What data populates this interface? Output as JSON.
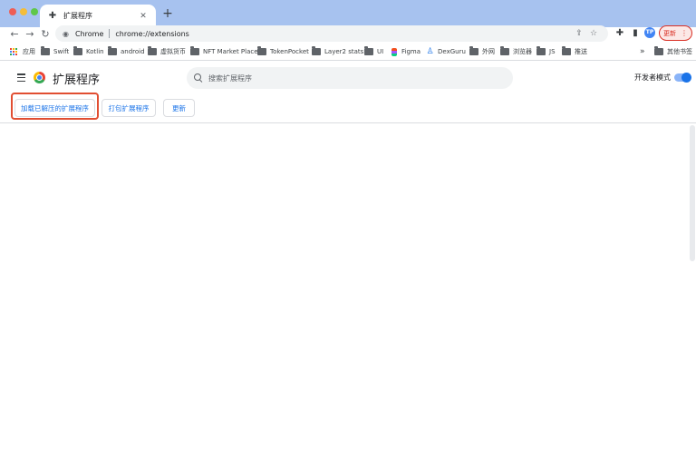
{
  "tab": {
    "title": "扩展程序",
    "icon": "puzzle-icon",
    "close": "✕",
    "new_tab": "+"
  },
  "address_bar": {
    "chip": "Chrome",
    "url": "chrome://extensions"
  },
  "profile": {
    "initials": "TP",
    "update_label": "更新",
    "menu": "⋮"
  },
  "bookmarks": {
    "items": [
      {
        "label": "应用",
        "icon": "apps-grid-icon"
      },
      {
        "label": "Swift",
        "icon": "folder-icon"
      },
      {
        "label": "Kotlin",
        "icon": "folder-icon"
      },
      {
        "label": "android",
        "icon": "folder-icon"
      },
      {
        "label": "虚拟货币",
        "icon": "folder-icon"
      },
      {
        "label": "NFT Market Place",
        "icon": "folder-icon"
      },
      {
        "label": "TokenPocket",
        "icon": "folder-icon"
      },
      {
        "label": "Layer2 stats",
        "icon": "folder-icon"
      },
      {
        "label": "UI",
        "icon": "folder-icon"
      },
      {
        "label": "Figma",
        "icon": "figma-icon"
      },
      {
        "label": "DexGuru",
        "icon": "dexguru-icon"
      },
      {
        "label": "外网",
        "icon": "folder-icon"
      },
      {
        "label": "浏览器",
        "icon": "folder-icon"
      },
      {
        "label": "JS",
        "icon": "folder-icon"
      },
      {
        "label": "推送",
        "icon": "folder-icon"
      }
    ],
    "overflow": "»",
    "other": "其他书签"
  },
  "extensions": {
    "title": "扩展程序",
    "search_placeholder": "搜索扩展程序",
    "dev_mode_label": "开发者模式",
    "dev_mode_on": true,
    "buttons": {
      "load_unpacked": "加载已解压的扩展程序",
      "pack": "打包扩展程序",
      "update": "更新"
    }
  },
  "colors": {
    "accent": "#1a73e8",
    "highlight": "#e14e32",
    "titlebar": "#a7c2ef"
  }
}
